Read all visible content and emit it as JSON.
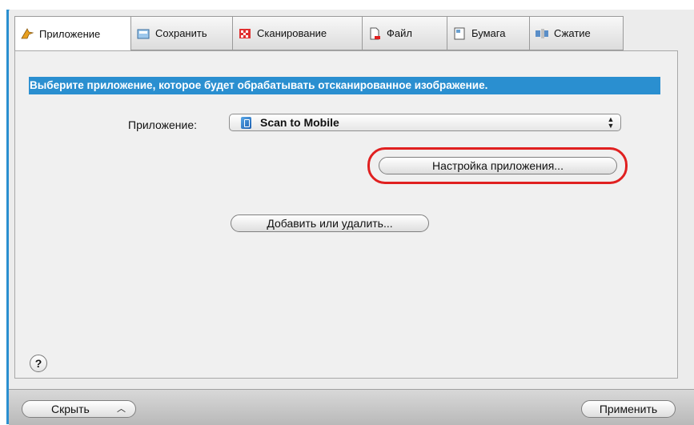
{
  "tabs": [
    {
      "label": "Приложение",
      "icon": "application-icon",
      "active": true
    },
    {
      "label": "Сохранить",
      "icon": "save-icon",
      "active": false
    },
    {
      "label": "Сканирование",
      "icon": "scan-icon",
      "active": false
    },
    {
      "label": "Файл",
      "icon": "file-icon",
      "active": false
    },
    {
      "label": "Бумага",
      "icon": "paper-icon",
      "active": false
    },
    {
      "label": "Сжатие",
      "icon": "compression-icon",
      "active": false
    }
  ],
  "main": {
    "instruction": "Выберите приложение, которое будет обрабатывать отсканированное изображение.",
    "app_label": "Приложение:",
    "app_selected": "Scan to Mobile",
    "app_settings_button": "Настройка приложения...",
    "add_remove_button": "Добавить или удалить..."
  },
  "footer": {
    "help": "?",
    "hide_button": "Скрыть",
    "apply_button": "Применить"
  },
  "colors": {
    "accent": "#2a8fd0",
    "highlight": "#e02020"
  }
}
